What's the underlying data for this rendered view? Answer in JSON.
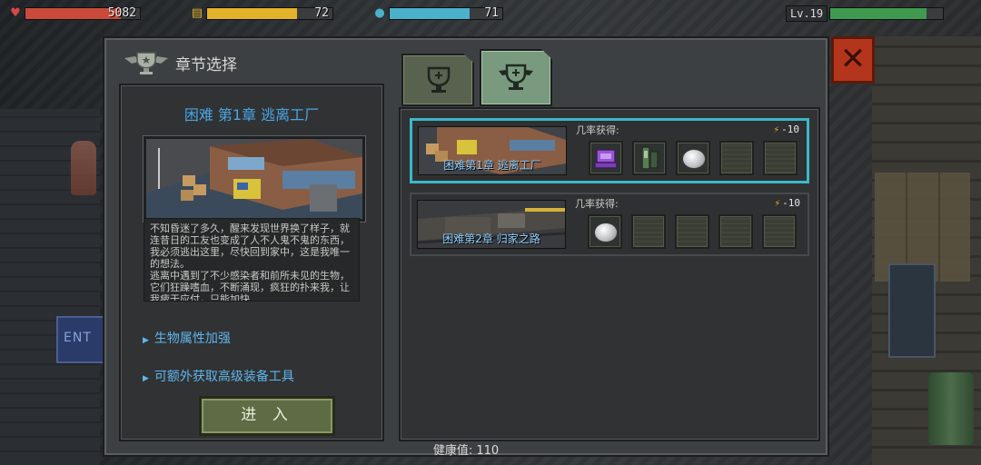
{
  "hud": {
    "hp": {
      "icon": "heart-icon",
      "value": "5082",
      "fill": 0.83,
      "color": "#c94a3b"
    },
    "food": {
      "icon": "food-can-icon",
      "value": "72",
      "fill": 0.72,
      "color": "#e2b22b"
    },
    "water": {
      "icon": "water-drop-icon",
      "value": "71",
      "fill": 0.71,
      "color": "#4bb0c9"
    },
    "level": {
      "label": "Lv.19",
      "fill": 0.85,
      "color": "#3f9a4f"
    }
  },
  "dialog": {
    "title": "章节选择",
    "emblem_icon": "winged-trophy-icon"
  },
  "left_panel": {
    "chapter_title": "困难 第1章 逃离工厂",
    "description": [
      "不知昏迷了多久，醒来发现世界换了样子，就连昔日的工友也变成了人不人鬼不鬼的东西，我必须逃出这里，尽快回到家中，这是我唯一的想法。",
      "逃离中遇到了不少感染者和前所未见的生物，它们狂躁嗜血，不断涌现，疯狂的扑来我，让我疲于应付，只能加快"
    ],
    "features": [
      "生物属性加强",
      "可额外获取高级装备工具"
    ],
    "enter_button": "进 入"
  },
  "tabs": [
    {
      "icon": "trophy-tab-icon",
      "active": false
    },
    {
      "icon": "winged-trophy-tab-icon",
      "active": true
    }
  ],
  "chapters": [
    {
      "name": "困难第1章 逃离工厂",
      "prob_label": "几率获得:",
      "cost": "-10",
      "selected": true,
      "rewards": [
        "purple-chest-icon",
        "green-tool-icon",
        "silver-coin-icon",
        "",
        ""
      ]
    },
    {
      "name": "困难第2章 归家之路",
      "prob_label": "几率获得:",
      "cost": "-10",
      "selected": false,
      "rewards": [
        "silver-coin-icon",
        "",
        "",
        "",
        ""
      ]
    }
  ],
  "footer": {
    "health": "健康值: 110"
  }
}
